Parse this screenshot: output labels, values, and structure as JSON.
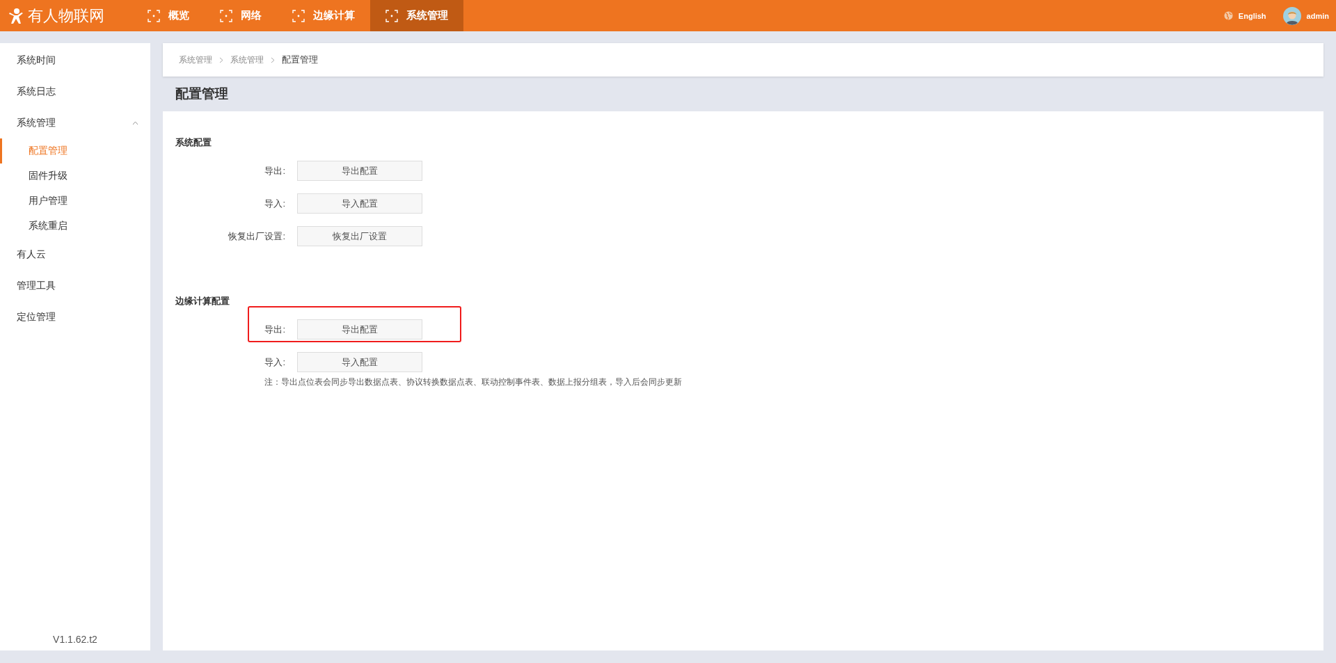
{
  "header": {
    "logo": "有人物联网",
    "nav": [
      {
        "label": "概览",
        "selected": false
      },
      {
        "label": "网络",
        "selected": false
      },
      {
        "label": "边缘计算",
        "selected": false
      },
      {
        "label": "系统管理",
        "selected": true
      }
    ],
    "language": "English",
    "user": "admin"
  },
  "sidebar": {
    "items": [
      {
        "label": "系统时间",
        "selected": false
      },
      {
        "label": "系统日志",
        "selected": false
      },
      {
        "label": "系统管理",
        "selected": false,
        "expanded": true,
        "children": [
          {
            "label": "配置管理",
            "selected": true
          },
          {
            "label": "固件升级",
            "selected": false
          },
          {
            "label": "用户管理",
            "selected": false
          },
          {
            "label": "系统重启",
            "selected": false
          }
        ]
      },
      {
        "label": "有人云",
        "selected": false
      },
      {
        "label": "管理工具",
        "selected": false
      },
      {
        "label": "定位管理",
        "selected": false
      }
    ],
    "version": "V1.1.62.t2"
  },
  "breadcrumb": [
    "系统管理",
    "系统管理",
    "配置管理"
  ],
  "page_title": "配置管理",
  "sections": [
    {
      "title": "系统配置",
      "rows": [
        {
          "label": "导出:",
          "button": "导出配置",
          "highlighted": false
        },
        {
          "label": "导入:",
          "button": "导入配置",
          "highlighted": false
        },
        {
          "label": "恢复出厂设置:",
          "button": "恢复出厂设置",
          "highlighted": false
        }
      ]
    },
    {
      "title": "边缘计算配置",
      "rows": [
        {
          "label": "导出:",
          "button": "导出配置",
          "highlighted": true
        },
        {
          "label": "导入:",
          "button": "导入配置",
          "highlighted": false
        }
      ],
      "note": "注：导出点位表会同步导出数据点表、协议转换数据点表、联动控制事件表、数据上报分组表，导入后会同步更新"
    }
  ]
}
